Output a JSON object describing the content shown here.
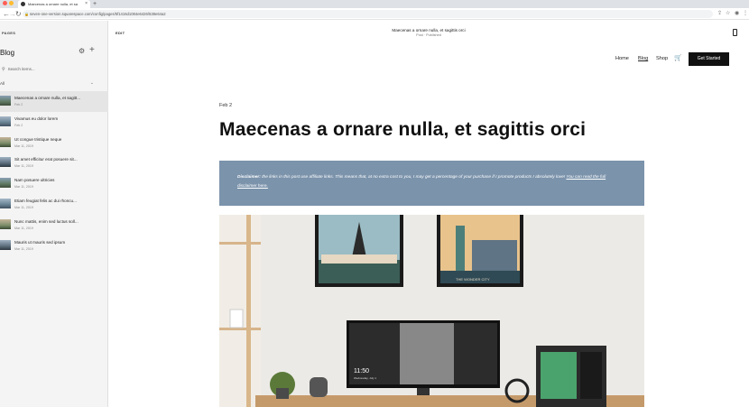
{
  "browser": {
    "tab_title": "Maecenas a ornare nulla, et sa",
    "url": "seven-one-version.squarespace.com/config/pages/5f1416d1084e6426/538e64a2",
    "colors": {
      "close": "#ff5f57",
      "minimize": "#febc2e",
      "maximize": "#28c840"
    }
  },
  "sidebar": {
    "section_label": "PAGES",
    "title": "Blog",
    "search_placeholder": "Search items...",
    "filter_label": "All",
    "posts": [
      {
        "title": "Maecenas a ornare nulla, et sagitt...",
        "date": "Feb 2"
      },
      {
        "title": "Vivamus eu dolor lorem",
        "date": "Feb 2"
      },
      {
        "title": "Ut congue tristique neque",
        "date": "Mar 11, 2019"
      },
      {
        "title": "Sit amet efficitur erat posuere sit...",
        "date": "Mar 11, 2019"
      },
      {
        "title": "Nam posuere ultricies",
        "date": "Mar 11, 2019"
      },
      {
        "title": "Etiam feugiat felis ac dui rhoncu...",
        "date": "Mar 11, 2019"
      },
      {
        "title": "Nunc mattis, enim sed luctus soll...",
        "date": "Mar 11, 2019"
      },
      {
        "title": "Mauris ut mauris sed ipsum",
        "date": "Mar 11, 2019"
      }
    ]
  },
  "editor": {
    "edit_label": "EDIT",
    "page_name": "Maecenas a ornare nulla, et sagittis orci",
    "page_status": "Post · Published"
  },
  "site": {
    "nav": {
      "home": "Home",
      "blog": "Blog",
      "shop": "Shop"
    },
    "cta": "Get Started",
    "post": {
      "date": "Feb 2",
      "title": "Maecenas a ornare nulla, et sagittis orci",
      "disclaimer_bold": "Disclaimer:",
      "disclaimer_text": " the links in this post use affiliate links. This means that, at no extra cost to you, I may get a percentage of your purchase if I promote products I absolutely love!",
      "disclaimer_link": "You can read the full disclaimer here."
    },
    "photo": {
      "left_poster_caption": "",
      "right_poster_caption": "THE WONDER CITY",
      "monitor_time": "11:50",
      "monitor_date": "Wednesday, July 1"
    },
    "colors": {
      "disclaimer_bg": "#7b93ab",
      "cta_bg": "#111111"
    }
  }
}
